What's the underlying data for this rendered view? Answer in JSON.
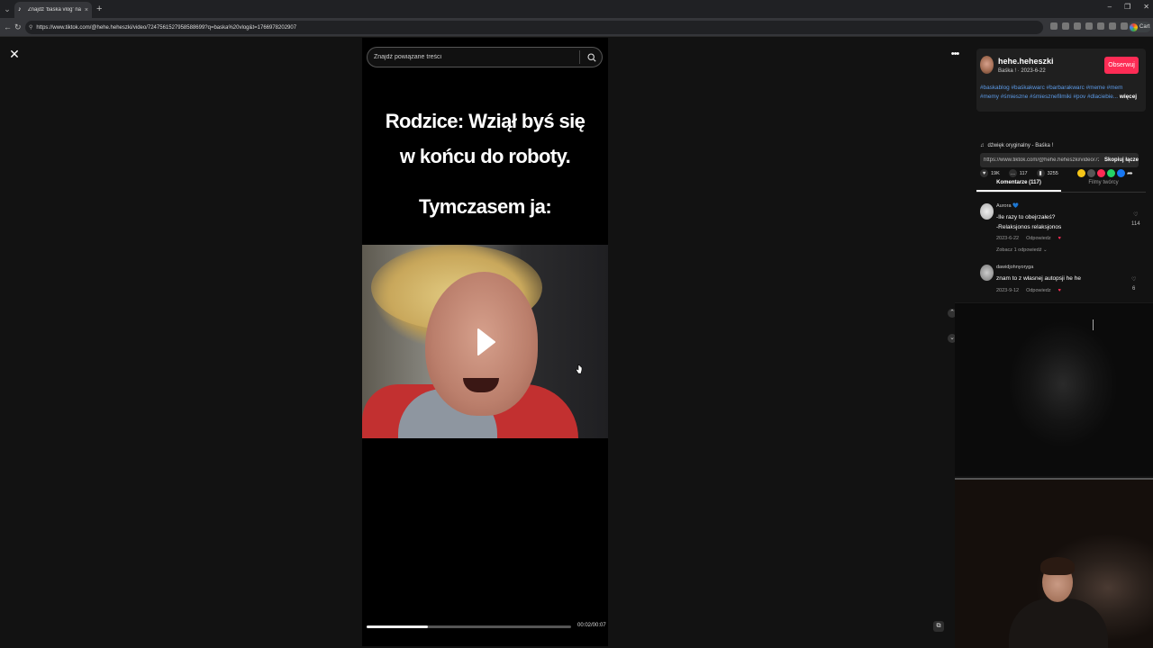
{
  "browser": {
    "tab_title": "Znajdź 'baska vlog' na TikTok | 'Wy",
    "tab_close": "×",
    "tab_new": "+",
    "url": "https://www.tiktok.com/@hehe.heheszki/video/7247561527958588699?q=baska%20vlog&t=1766978202907",
    "profile_label": "Cart"
  },
  "search": {
    "placeholder": "Znajdź powiązane treści"
  },
  "video": {
    "caption_line1": "Rodzice: Wziął byś się w końcu do roboty.",
    "caption_line2": "Tymczasem ja:",
    "time": "00:02/00:07",
    "progress": 0.3
  },
  "author": {
    "name": "hehe.heheszki",
    "subtitle": "Baśka ! · 2023-6-22",
    "follow_label": "Obserwuj",
    "description": "#baskablog #baśkakwarc #barbarakwarc #meme #mem #memy #śmieszne #śmiesznefilmiki #pov #dlaciebie...",
    "more_label": "więcej",
    "sound": "dźwięk oryginalny - Baśka !"
  },
  "stats": {
    "likes": "19K",
    "comments": "117",
    "saves": "3255"
  },
  "share": {
    "link": "https://www.tiktok.com/@hehe.heheszki/video/72...",
    "copy_label": "Skopiuj łącze",
    "colors": [
      "#f5c518",
      "#555555",
      "#fe2c55",
      "#25d366",
      "#1877f2"
    ]
  },
  "tabs": {
    "comments_label": "Komentarze (117)",
    "creator_label": "Filmy twórcy"
  },
  "comments": [
    {
      "user": "Aurora 💙",
      "text": "-Ile razy to obejrzałeś?\n-Relaksjonos relaksjonos",
      "date": "2023-6-22",
      "reply_label": "Odpowiedz",
      "likes": "114",
      "replies_label": "Zobacz 1 odpowiedź ⌄"
    },
    {
      "user": "dawidjohnyoryga",
      "text": "znam to z własnej autopsji he he",
      "date": "2023-9-12",
      "reply_label": "Odpowiedz",
      "likes": "6"
    }
  ],
  "accent": "#fe2c55"
}
